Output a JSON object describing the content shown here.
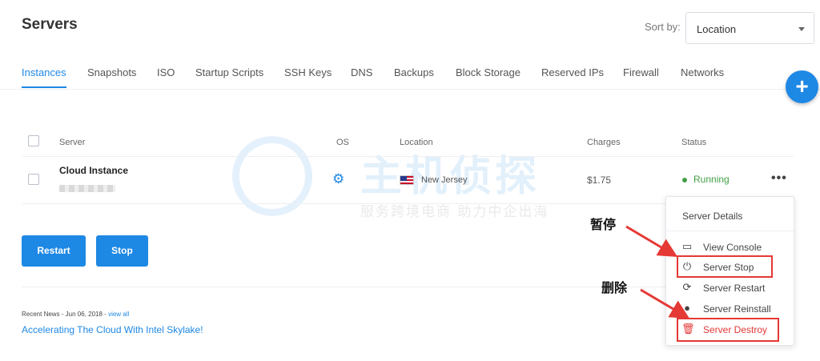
{
  "header": {
    "title": "Servers",
    "sort_label": "Sort by:",
    "sort_value": "Location"
  },
  "tabs": [
    {
      "label": "Instances",
      "active": true
    },
    {
      "label": "Snapshots"
    },
    {
      "label": "ISO"
    },
    {
      "label": "Startup Scripts"
    },
    {
      "label": "SSH Keys"
    },
    {
      "label": "DNS"
    },
    {
      "label": "Backups"
    },
    {
      "label": "Block Storage"
    },
    {
      "label": "Reserved IPs"
    },
    {
      "label": "Firewall"
    },
    {
      "label": "Networks"
    }
  ],
  "add_button_icon": "plus-icon",
  "table": {
    "headers": {
      "server": "Server",
      "os": "OS",
      "location": "Location",
      "charges": "Charges",
      "status": "Status"
    },
    "rows": [
      {
        "name": "Cloud Instance",
        "os_icon": "gear-icon",
        "location": "New Jersey",
        "flag": "us-flag-icon",
        "charges": "$1.75",
        "status": "Running",
        "status_color": "#43a047"
      }
    ]
  },
  "actions": {
    "restart": "Restart",
    "stop": "Stop"
  },
  "news": {
    "meta": "Recent News - Jun 06, 2018 - ",
    "view_all": "view all",
    "title": "Accelerating The Cloud With Intel Skylake!"
  },
  "menu": {
    "header": "Server Details",
    "items": [
      {
        "label": "View Console",
        "icon": "console-icon"
      },
      {
        "label": "Server Stop",
        "icon": "power-icon"
      },
      {
        "label": "Server Restart",
        "icon": "restart-icon"
      },
      {
        "label": "Server Reinstall",
        "icon": "reinstall-icon"
      },
      {
        "label": "Server Destroy",
        "icon": "trash-icon",
        "color": "#e53935"
      }
    ]
  },
  "annotations": {
    "pause": "暂停",
    "delete": "删除"
  },
  "watermark": {
    "title": "主机侦探",
    "subtitle": "服务跨境电商 助力中企出海"
  },
  "colors": {
    "accent": "#1e88e5",
    "success": "#43a047",
    "danger": "#e53935"
  }
}
